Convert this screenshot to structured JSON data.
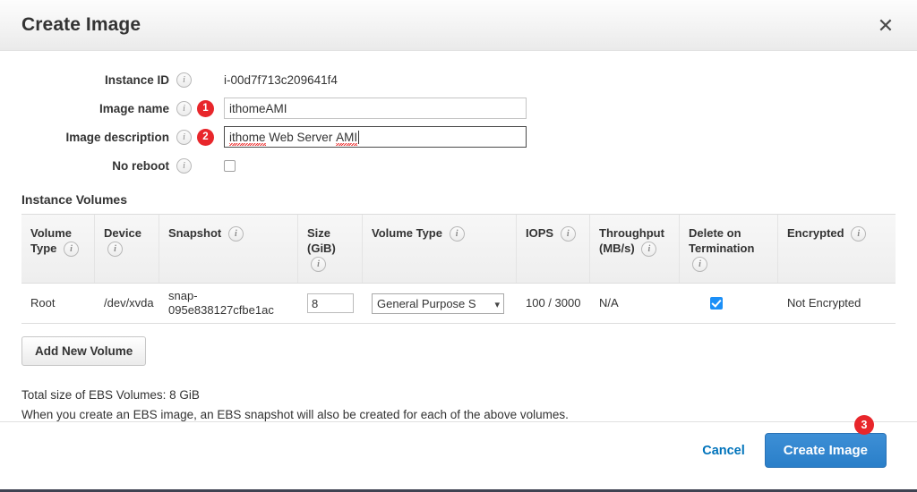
{
  "dialog": {
    "title": "Create Image",
    "close_icon": "close-icon"
  },
  "form": {
    "instance_id": {
      "label": "Instance ID",
      "value": "i-00d7f713c209641f4"
    },
    "image_name": {
      "label": "Image name",
      "value": "ithomeAMI",
      "badge": "1"
    },
    "image_description": {
      "label": "Image description",
      "value_part1": "ithome",
      "value_part2": " Web Server ",
      "value_part3": "AMI",
      "badge": "2"
    },
    "no_reboot": {
      "label": "No reboot",
      "checked": false
    }
  },
  "volumes": {
    "section_title": "Instance Volumes",
    "headers": {
      "volume_type": "Volume Type",
      "device": "Device",
      "snapshot": "Snapshot",
      "size": "Size (GiB)",
      "size_line1": "Size",
      "size_line2": "(GiB)",
      "vtype": "Volume Type",
      "iops": "IOPS",
      "throughput_line1": "Throughput",
      "throughput_line2": "(MB/s)",
      "delete_line1": "Delete on",
      "delete_line2": "Termination",
      "encrypted": "Encrypted"
    },
    "row": {
      "volume_type": "Root",
      "device": "/dev/xvda",
      "snapshot_line1": "snap-",
      "snapshot_line2": "095e838127cfbe1ac",
      "size": "8",
      "vtype_selected": "General Purpose S",
      "iops": "100 / 3000",
      "throughput": "N/A",
      "delete_on_termination": true,
      "encrypted": "Not Encrypted"
    },
    "add_button": "Add New Volume"
  },
  "notes": {
    "total_size": "Total size of EBS Volumes: 8 GiB",
    "snapshot_note": "When you create an EBS image, an EBS snapshot will also be created for each of the above volumes."
  },
  "footer": {
    "cancel": "Cancel",
    "create": "Create Image",
    "badge": "3"
  },
  "colors": {
    "accent": "#2a7fc9",
    "link": "#0073bb",
    "badge_red": "#e8262b",
    "checkbox_blue": "#1b8ff7"
  }
}
